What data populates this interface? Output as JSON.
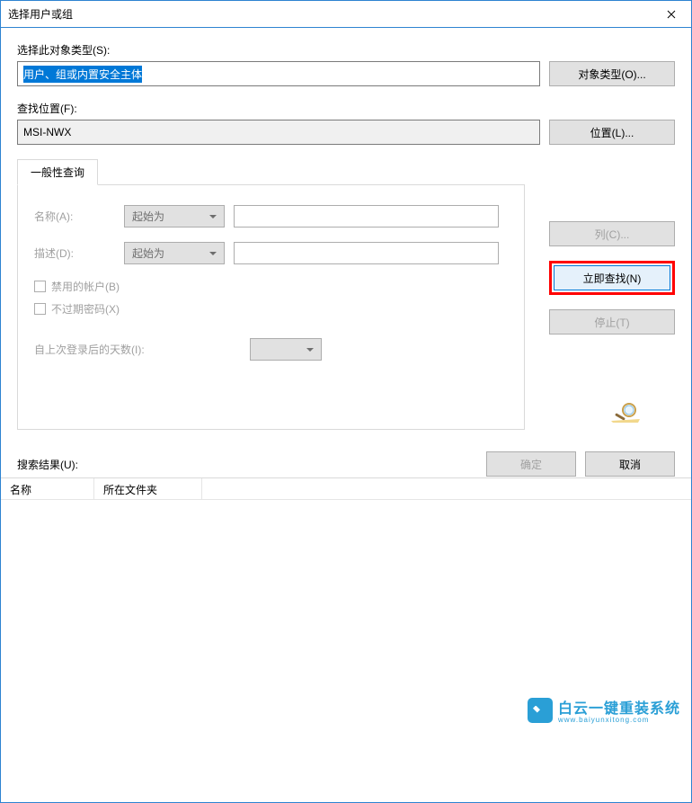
{
  "titlebar": {
    "title": "选择用户或组"
  },
  "object_type": {
    "label": "选择此对象类型(S):",
    "value": "用户、组或内置安全主体",
    "button": "对象类型(O)..."
  },
  "location": {
    "label": "查找位置(F):",
    "value": "MSI-NWX",
    "button": "位置(L)..."
  },
  "query": {
    "tab_label": "一般性查询",
    "name_label": "名称(A):",
    "name_combo": "起始为",
    "desc_label": "描述(D):",
    "desc_combo": "起始为",
    "disabled_accounts": "禁用的帐户(B)",
    "non_expiring": "不过期密码(X)",
    "days_since_login": "自上次登录后的天数(I):"
  },
  "right_buttons": {
    "columns": "列(C)...",
    "find_now": "立即查找(N)",
    "stop": "停止(T)"
  },
  "bottom_buttons": {
    "ok": "确定",
    "cancel": "取消"
  },
  "results": {
    "label": "搜索结果(U):",
    "col_name": "名称",
    "col_folder": "所在文件夹"
  },
  "watermark": {
    "cn": "白云一键重装系统",
    "en": "www.baiyunxitong.com"
  }
}
